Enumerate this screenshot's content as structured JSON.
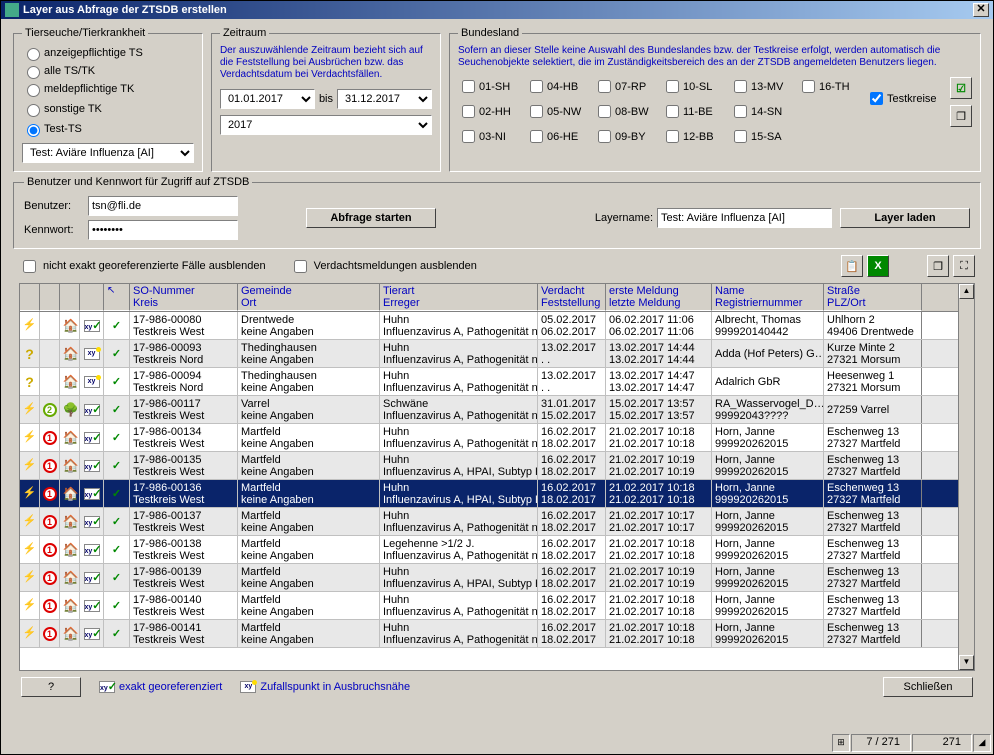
{
  "window": {
    "title": "Layer aus Abfrage der ZTSDB erstellen"
  },
  "ts": {
    "legend": "Tierseuche/Tierkrankheit",
    "r1": "anzeigepflichtige TS",
    "r2": "meldepflichtige TK",
    "r3": "sonstige TK",
    "r4": "Test-TS",
    "r5": "alle TS/TK",
    "select": "Test: Aviäre Influenza [AI]"
  },
  "zr": {
    "legend": "Zeitraum",
    "note": "Der auszuwählende Zeitraum bezieht sich auf die Feststellung bei Ausbrüchen bzw. das Verdachtsdatum bei Verdachtsfällen.",
    "from": "01.01.2017",
    "to_label": "bis",
    "to": "31.12.2017",
    "year": "2017"
  },
  "bl": {
    "legend": "Bundesland",
    "note": "Sofern an dieser Stelle keine Auswahl des Bundeslandes bzw. der Testkreise erfolgt, werden automatisch die Seuchenobjekte selektiert, die im Zuständigkeitsbereich des an der ZTSDB angemeldeten Benutzers liegen.",
    "items": [
      "01-SH",
      "02-HH",
      "03-NI",
      "04-HB",
      "05-NW",
      "06-HE",
      "07-RP",
      "08-BW",
      "09-BY",
      "10-SL",
      "11-BE",
      "12-BB",
      "13-MV",
      "14-SN",
      "15-SA",
      "16-TH"
    ],
    "testkreise": "Testkreise"
  },
  "auth": {
    "legend": "Benutzer und Kennwort für Zugriff auf ZTSDB",
    "user_label": "Benutzer:",
    "pass_label": "Kennwort:",
    "user": "tsn@fli.de",
    "pass_value": "••••••••",
    "btn_query": "Abfrage starten",
    "layer_label": "Layername:",
    "layer_name": "Test: Aviäre Influenza [AI]",
    "btn_load": "Layer laden"
  },
  "filters": {
    "georef": "nicht exakt georeferenzierte Fälle ausblenden",
    "verdacht": "Verdachtsmeldungen ausblenden"
  },
  "headers": {
    "c5a": "SO-Nummer",
    "c5b": "Kreis",
    "c6a": "Gemeinde",
    "c6b": "Ort",
    "c7a": "Tierart",
    "c7b": "Erreger",
    "c8a": "Verdacht",
    "c8b": "Feststellung",
    "c9a": "erste Meldung",
    "c9b": "letzte Meldung",
    "c10a": "Name",
    "c10b": "Registriernummer",
    "c11a": "Straße",
    "c11b": "PLZ/Ort"
  },
  "rows": [
    {
      "i0": "bolt",
      "i1": "",
      "i2": "house",
      "i3": "xy-g",
      "so": "17-986-00080",
      "kr": "Testkreis West",
      "gm": "Drentwede",
      "ort": "keine Angaben",
      "ta": "Huhn",
      "er": "Influenzavirus A, Pathogenität n…",
      "vd": "05.02.2017",
      "fs": "06.02.2017",
      "em": "06.02.2017 11:06",
      "lm": "06.02.2017 11:06",
      "nm": "Albrecht, Thomas",
      "rn": "999920140442",
      "st": "Uhlhorn 2",
      "po": "49406 Drentwede"
    },
    {
      "i0": "q",
      "i1": "",
      "i2": "house",
      "i3": "xy-y",
      "so": "17-986-00093",
      "kr": "Testkreis Nord",
      "gm": "Thedinghausen",
      "ort": "keine Angaben",
      "ta": "Huhn",
      "er": "Influenzavirus A, Pathogenität n…",
      "vd": "13.02.2017",
      "fs": ". .",
      "em": "13.02.2017 14:44",
      "lm": "13.02.2017 14:44",
      "nm": "Adda (Hof Peters) G…",
      "rn": "",
      "st": "Kurze Minte 2",
      "po": "27321 Morsum",
      "alt": true
    },
    {
      "i0": "q",
      "i1": "",
      "i2": "house",
      "i3": "xy-y",
      "so": "17-986-00094",
      "kr": "Testkreis Nord",
      "gm": "Thedinghausen",
      "ort": "keine Angaben",
      "ta": "Huhn",
      "er": "Influenzavirus A, Pathogenität n…",
      "vd": "13.02.2017",
      "fs": ". .",
      "em": "13.02.2017 14:47",
      "lm": "13.02.2017 14:47",
      "nm": "Adalrich GbR",
      "rn": "",
      "st": "Heesenweg 1",
      "po": "27321 Morsum"
    },
    {
      "i0": "bolt",
      "i1": "n2",
      "i2": "tree",
      "i3": "xy-g",
      "so": "17-986-00117",
      "kr": "Testkreis West",
      "gm": "Varrel",
      "ort": "keine Angaben",
      "ta": "Schwäne",
      "er": "Influenzavirus A, Pathogenität n…",
      "vd": "31.01.2017",
      "fs": "15.02.2017",
      "em": "15.02.2017 13:57",
      "lm": "15.02.2017 13:57",
      "nm": "RA_Wasservogel_D…",
      "rn": "99992043????",
      "st": "",
      "po": "27259 Varrel",
      "alt": true
    },
    {
      "i0": "bolt",
      "i1": "n1",
      "i2": "house",
      "i3": "xy-g",
      "so": "17-986-00134",
      "kr": "Testkreis West",
      "gm": "Martfeld",
      "ort": "keine Angaben",
      "ta": "Huhn",
      "er": "Influenzavirus A, Pathogenität n…",
      "vd": "16.02.2017",
      "fs": "18.02.2017",
      "em": "21.02.2017 10:18",
      "lm": "21.02.2017 10:18",
      "nm": "Horn, Janne",
      "rn": "999920262015",
      "st": "Eschenweg 13",
      "po": "27327 Martfeld"
    },
    {
      "i0": "bolt",
      "i1": "n1",
      "i2": "house",
      "i3": "xy-g",
      "so": "17-986-00135",
      "kr": "Testkreis West",
      "gm": "Martfeld",
      "ort": "keine Angaben",
      "ta": "Huhn",
      "er": "Influenzavirus A, HPAI, Subtyp H…",
      "vd": "16.02.2017",
      "fs": "18.02.2017",
      "em": "21.02.2017 10:19",
      "lm": "21.02.2017 10:19",
      "nm": "Horn, Janne",
      "rn": "999920262015",
      "st": "Eschenweg 13",
      "po": "27327 Martfeld",
      "alt": true
    },
    {
      "i0": "bolt",
      "i1": "n1",
      "i2": "house",
      "i3": "xy-g",
      "so": "17-986-00136",
      "kr": "Testkreis West",
      "gm": "Martfeld",
      "ort": "keine Angaben",
      "ta": "Huhn",
      "er": "Influenzavirus A, HPAI, Subtyp H…",
      "vd": "16.02.2017",
      "fs": "18.02.2017",
      "em": "21.02.2017 10:18",
      "lm": "21.02.2017 10:18",
      "nm": "Horn, Janne",
      "rn": "999920262015",
      "st": "Eschenweg 13",
      "po": "27327 Martfeld",
      "sel": true
    },
    {
      "i0": "bolt",
      "i1": "n1",
      "i2": "house",
      "i3": "xy-g",
      "so": "17-986-00137",
      "kr": "Testkreis West",
      "gm": "Martfeld",
      "ort": "keine Angaben",
      "ta": "Huhn",
      "er": "Influenzavirus A, Pathogenität n…",
      "vd": "16.02.2017",
      "fs": "18.02.2017",
      "em": "21.02.2017 10:17",
      "lm": "21.02.2017 10:17",
      "nm": "Horn, Janne",
      "rn": "999920262015",
      "st": "Eschenweg 13",
      "po": "27327 Martfeld",
      "alt": true
    },
    {
      "i0": "bolt",
      "i1": "n1",
      "i2": "house",
      "i3": "xy-g",
      "so": "17-986-00138",
      "kr": "Testkreis West",
      "gm": "Martfeld",
      "ort": "keine Angaben",
      "ta": "Legehenne >1/2 J.",
      "er": "Influenzavirus A, Pathogenität n…",
      "vd": "16.02.2017",
      "fs": "18.02.2017",
      "em": "21.02.2017 10:18",
      "lm": "21.02.2017 10:18",
      "nm": "Horn, Janne",
      "rn": "999920262015",
      "st": "Eschenweg 13",
      "po": "27327 Martfeld"
    },
    {
      "i0": "bolt",
      "i1": "n1",
      "i2": "house",
      "i3": "xy-g",
      "so": "17-986-00139",
      "kr": "Testkreis West",
      "gm": "Martfeld",
      "ort": "keine Angaben",
      "ta": "Huhn",
      "er": "Influenzavirus A, HPAI, Subtyp H…",
      "vd": "16.02.2017",
      "fs": "18.02.2017",
      "em": "21.02.2017 10:19",
      "lm": "21.02.2017 10:19",
      "nm": "Horn, Janne",
      "rn": "999920262015",
      "st": "Eschenweg 13",
      "po": "27327 Martfeld",
      "alt": true
    },
    {
      "i0": "bolt",
      "i1": "n1",
      "i2": "house",
      "i3": "xy-g",
      "so": "17-986-00140",
      "kr": "Testkreis West",
      "gm": "Martfeld",
      "ort": "keine Angaben",
      "ta": "Huhn",
      "er": "Influenzavirus A, Pathogenität n…",
      "vd": "16.02.2017",
      "fs": "18.02.2017",
      "em": "21.02.2017 10:18",
      "lm": "21.02.2017 10:18",
      "nm": "Horn, Janne",
      "rn": "999920262015",
      "st": "Eschenweg 13",
      "po": "27327 Martfeld"
    },
    {
      "i0": "bolt",
      "i1": "n1",
      "i2": "house",
      "i3": "xy-g",
      "so": "17-986-00141",
      "kr": "Testkreis West",
      "gm": "Martfeld",
      "ort": "keine Angaben",
      "ta": "Huhn",
      "er": "Influenzavirus A, Pathogenität n…",
      "vd": "16.02.2017",
      "fs": "18.02.2017",
      "em": "21.02.2017 10:18",
      "lm": "21.02.2017 10:18",
      "nm": "Horn, Janne",
      "rn": "999920262015",
      "st": "Eschenweg 13",
      "po": "27327 Martfeld",
      "alt": true
    }
  ],
  "footer": {
    "help": "?",
    "leg1": "exakt georeferenziert",
    "leg2": "Zufallspunkt in Ausbruchsnähe",
    "close": "Schließen"
  },
  "status": {
    "pos": "7 / 271",
    "total": "271"
  }
}
